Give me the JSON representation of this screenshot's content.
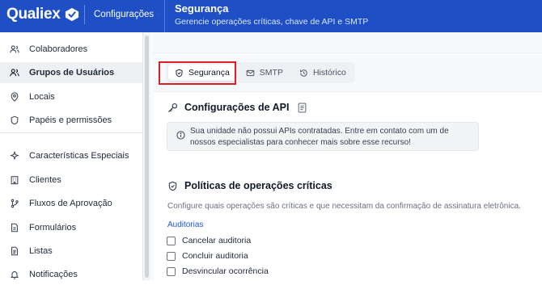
{
  "header": {
    "brand": "Qualiex",
    "module": "Configurações",
    "title": "Segurança",
    "subtitle": "Gerencie operações críticas, chave de API e SMTP"
  },
  "sidebar": {
    "items": [
      {
        "label": "Colaboradores",
        "icon": "users-icon"
      },
      {
        "label": "Grupos de Usuários",
        "icon": "user-group-icon"
      },
      {
        "label": "Locais",
        "icon": "location-pin-icon"
      },
      {
        "label": "Papéis e permissões",
        "icon": "shield-icon"
      },
      {
        "label": "Características Especiais",
        "icon": "sparkles-icon"
      },
      {
        "label": "Clientes",
        "icon": "building-icon"
      },
      {
        "label": "Fluxos de Aprovação",
        "icon": "branch-icon"
      },
      {
        "label": "Formulários",
        "icon": "form-icon"
      },
      {
        "label": "Listas",
        "icon": "list-icon"
      },
      {
        "label": "Notificações",
        "icon": "bell-icon"
      }
    ],
    "active_index": 1
  },
  "tabs": [
    {
      "label": "Segurança",
      "icon": "shield-check-icon",
      "active": true
    },
    {
      "label": "SMTP",
      "icon": "mail-icon",
      "active": false
    },
    {
      "label": "Histórico",
      "icon": "history-icon",
      "active": false
    }
  ],
  "api_section": {
    "title": "Configurações de API",
    "alert": "Sua unidade não possui APIs contratadas. Entre em contato com um de nossos especialistas para conhecer mais sobre esse recurso!"
  },
  "critical_section": {
    "title": "Políticas de operações críticas",
    "description": "Configure quais operações são críticas e que necessitam da confirmação de assinatura eletrônica.",
    "group_label": "Auditorias",
    "options": [
      {
        "label": "Cancelar auditoria",
        "checked": false
      },
      {
        "label": "Concluir auditoria",
        "checked": false
      },
      {
        "label": "Desvincular ocorrência",
        "checked": false
      }
    ]
  },
  "colors": {
    "header_bg": "#1e4fc4",
    "highlight_border": "#dc1f26",
    "link_blue": "#1e56d6"
  }
}
